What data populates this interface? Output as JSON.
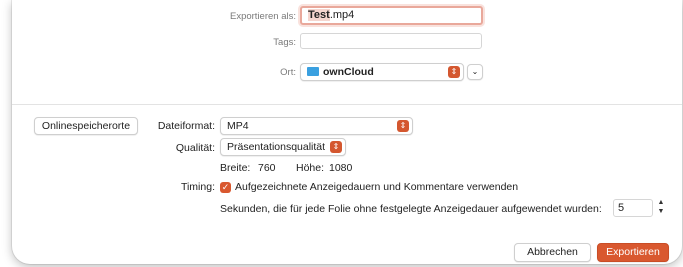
{
  "save": {
    "export_as_label": "Exportieren als:",
    "filename_stem": "Test",
    "filename_ext": ".mp4",
    "tags_label": "Tags:",
    "tags_value": "",
    "location_label": "Ort:",
    "location_value": "ownCloud",
    "online_locations_button": "Onlinespeicherorte"
  },
  "options": {
    "format_label": "Dateiformat:",
    "format_value": "MP4",
    "quality_label": "Qualität:",
    "quality_value": "Präsentationsqualität",
    "width_label": "Breite:",
    "width_value": "760",
    "height_label": "Höhe:",
    "height_value": "1080",
    "timing_label": "Timing:",
    "timing_checkbox_label": "Aufgezeichnete Anzeigedauern und Kommentare verwenden",
    "timing_checked": true,
    "seconds_label": "Sekunden, die für jede Folie ohne festgelegte Anzeigedauer aufgewendet wurden:",
    "seconds_value": "5"
  },
  "footer": {
    "cancel_label": "Abbrechen",
    "export_label": "Exportieren"
  },
  "colors": {
    "accent": "#d9582f",
    "focus_ring": "#e9a89b",
    "folder": "#3aa0e0"
  }
}
